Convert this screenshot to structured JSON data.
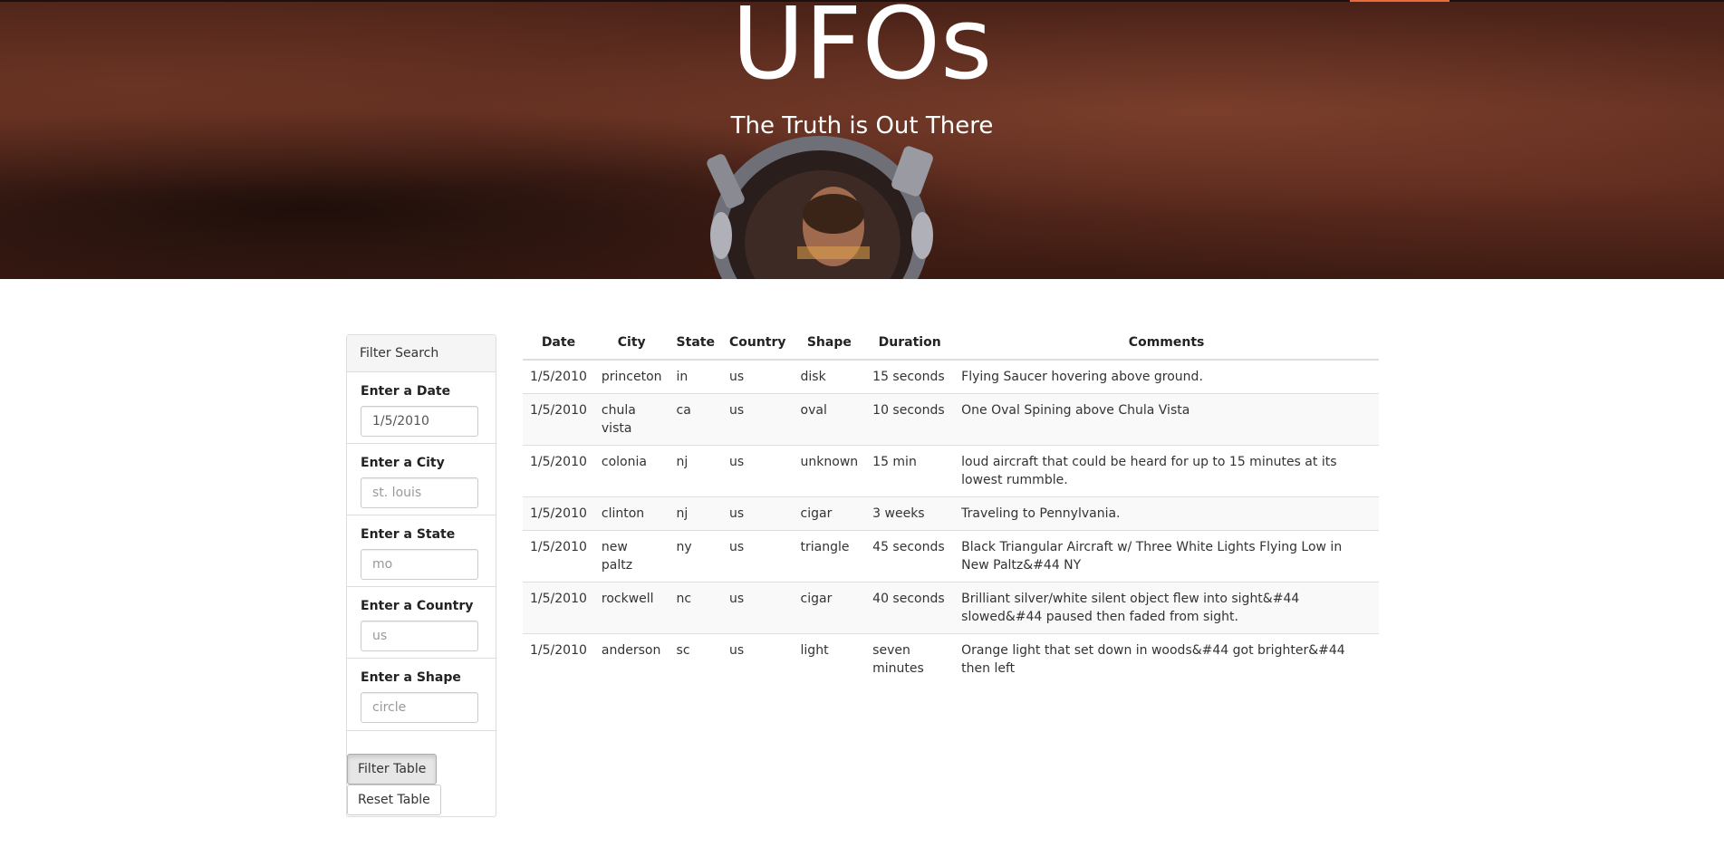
{
  "hero": {
    "title": "UFOs",
    "subtitle": "The Truth is Out There"
  },
  "sidebar": {
    "heading": "Filter Search",
    "filters": [
      {
        "label": "Enter a Date",
        "value": "1/5/2010",
        "placeholder": ""
      },
      {
        "label": "Enter a City",
        "value": "",
        "placeholder": "st. louis"
      },
      {
        "label": "Enter a State",
        "value": "",
        "placeholder": "mo"
      },
      {
        "label": "Enter a Country",
        "value": "",
        "placeholder": "us"
      },
      {
        "label": "Enter a Shape",
        "value": "",
        "placeholder": "circle"
      }
    ],
    "filter_button": "Filter Table",
    "reset_button": "Reset Table"
  },
  "table": {
    "headers": [
      "Date",
      "City",
      "State",
      "Country",
      "Shape",
      "Duration",
      "Comments"
    ],
    "rows": [
      [
        "1/5/2010",
        "princeton",
        "in",
        "us",
        "disk",
        "15 seconds",
        "Flying Saucer hovering above ground."
      ],
      [
        "1/5/2010",
        "chula vista",
        "ca",
        "us",
        "oval",
        "10 seconds",
        "One Oval Spining above Chula Vista"
      ],
      [
        "1/5/2010",
        "colonia",
        "nj",
        "us",
        "unknown",
        "15 min",
        "loud aircraft that could be heard for up to 15 minutes at its lowest rummble."
      ],
      [
        "1/5/2010",
        "clinton",
        "nj",
        "us",
        "cigar",
        "3 weeks",
        "Traveling to Pennylvania."
      ],
      [
        "1/5/2010",
        "new paltz",
        "ny",
        "us",
        "triangle",
        "45 seconds",
        "Black Triangular Aircraft w/ Three White Lights Flying Low in New Paltz&#44 NY"
      ],
      [
        "1/5/2010",
        "rockwell",
        "nc",
        "us",
        "cigar",
        "40 seconds",
        "Brilliant silver/white silent object flew into sight&#44 slowed&#44 paused then faded from sight."
      ],
      [
        "1/5/2010",
        "anderson",
        "sc",
        "us",
        "light",
        "seven minutes",
        "Orange light that set down in woods&#44 got brighter&#44 then left"
      ]
    ]
  }
}
